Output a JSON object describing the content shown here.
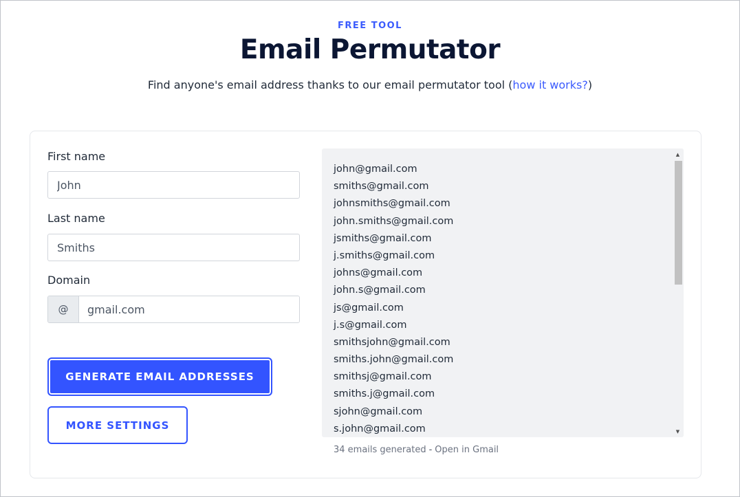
{
  "header": {
    "eyebrow": "FREE TOOL",
    "title": "Email Permutator",
    "subtitle_text": "Find anyone's email address thanks to our email permutator tool (",
    "subtitle_link": "how it works?",
    "subtitle_close": ")"
  },
  "form": {
    "first_name_label": "First name",
    "first_name_value": "John",
    "last_name_label": "Last name",
    "last_name_value": "Smiths",
    "domain_label": "Domain",
    "domain_prefix": "@",
    "domain_value": "gmail.com",
    "generate_button": "GENERATE EMAIL ADDRESSES",
    "settings_button": "MORE SETTINGS"
  },
  "results": {
    "emails": [
      "john@gmail.com",
      "smiths@gmail.com",
      "johnsmiths@gmail.com",
      "john.smiths@gmail.com",
      "jsmiths@gmail.com",
      "j.smiths@gmail.com",
      "johns@gmail.com",
      "john.s@gmail.com",
      "js@gmail.com",
      "j.s@gmail.com",
      "smithsjohn@gmail.com",
      "smiths.john@gmail.com",
      "smithsj@gmail.com",
      "smiths.j@gmail.com",
      "sjohn@gmail.com",
      "s.john@gmail.com"
    ],
    "count_text": "34 emails generated",
    "separator": "-",
    "open_gmail": "Open in Gmail"
  },
  "icons": {
    "scroll_up": "triangle-up-icon",
    "scroll_down": "triangle-down-icon"
  },
  "colors": {
    "accent": "#3354ff",
    "title": "#0b1633",
    "results_bg": "#f1f2f4"
  }
}
